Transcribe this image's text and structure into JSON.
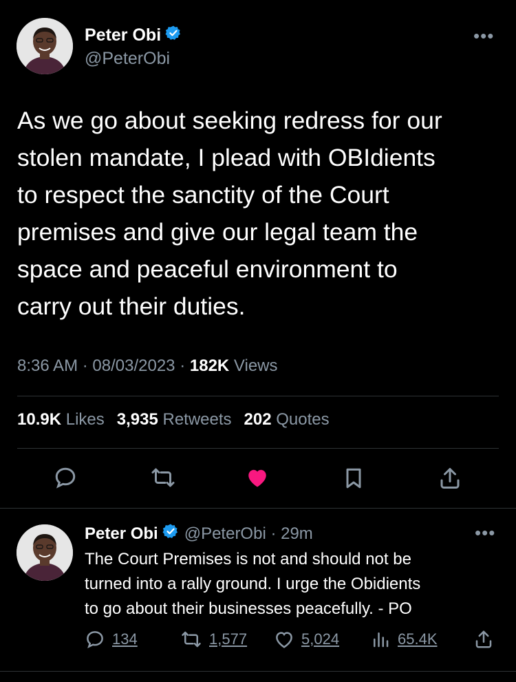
{
  "main_tweet": {
    "author_name": "Peter Obi",
    "handle": "@PeterObi",
    "text": "As we go about seeking redress for our\nstolen mandate, I plead with OBIdients\nto respect the sanctity of the Court\npremises and give our legal team the\nspace and peaceful environment to\ncarry out their duties.",
    "time": "8:36 AM",
    "date": "08/03/2023",
    "views_count": "182K",
    "views_label": "Views",
    "likes_count": "10.9K",
    "likes_label": "Likes",
    "retweets_count": "3,935",
    "retweets_label": "Retweets",
    "quotes_count": "202",
    "quotes_label": "Quotes"
  },
  "reply_tweet": {
    "author_name": "Peter Obi",
    "handle": "@PeterObi",
    "time_ago": "29m",
    "text": "The Court Premises is not and should not be\nturned into a rally ground. I urge the Obidients\nto go about their businesses peacefully.  - PO",
    "replies": "134",
    "retweets": "1,577",
    "likes": "5,024",
    "views": "65.4K"
  },
  "colors": {
    "accent_blue": "#1d9bf0",
    "like_pink": "#f91880",
    "muted": "#8b98a5"
  },
  "icons": [
    "more-icon",
    "verified-badge-icon",
    "reply-icon",
    "retweet-icon",
    "like-icon",
    "bookmark-icon",
    "share-icon",
    "views-icon"
  ]
}
